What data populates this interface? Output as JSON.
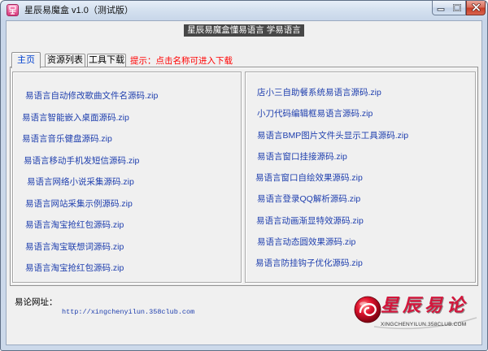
{
  "window": {
    "title": "星辰易魔盒 v1.0（测试版）",
    "icons": {
      "app": "app-icon",
      "minimize": "minimize-icon",
      "maximize": "maximize-icon",
      "close": "close-icon"
    }
  },
  "banner": {
    "text": "星辰易魔盒懂易语言 学易语言"
  },
  "tabs": [
    {
      "label": "主页",
      "selected": true
    },
    {
      "label": "资源列表",
      "selected": false
    },
    {
      "label": "工具下载",
      "selected": false
    }
  ],
  "hint": "提示：点击名称可进入下载",
  "left_list": [
    "易语言自动修改歌曲文件名源码.zip",
    "易语言智能嵌入桌面源码.zip",
    "易语言音乐健盘源码.zip",
    "易语言移动手机发短信源码.zip",
    "易语言网络小说采集源码.zip",
    "易语言网站采集示例源码.zip",
    "易语言淘宝抢红包源码.zip",
    "易语言淘宝联想词源码.zip",
    "易语言淘宝抢红包源码.zip"
  ],
  "right_list": [
    "店小三自助餐系统易语言源码.zip",
    "小刀代码编辑框易语言源码.zip",
    "易语言BMP图片文件头显示工具源码.zip",
    "易语言窗口挂接源码.zip",
    "易语言窗口自绘效果源码.zip",
    "易语言登录QQ解析源码.zip",
    "易语言动画渐显特效源码.zip",
    "易语言动态圆效果源码.zip",
    "易语言防挂钩子优化源码.zip"
  ],
  "footer": {
    "site_label": "易论网址：",
    "site_url": "http://xingchenyilun.358club.com",
    "logo": {
      "text": "星辰易论",
      "subtext": "XINGCHENYILUN.358CLUB.COM",
      "icon": "logo-swirl-icon"
    }
  },
  "colors": {
    "link": "#1f3fae",
    "hint": "#ff0000",
    "selected_tab": "#0040d0",
    "banner_bg": "#474747",
    "banner_text": "#ffffff",
    "logo_red": "#d3163c",
    "close_button": "#c63a22"
  }
}
